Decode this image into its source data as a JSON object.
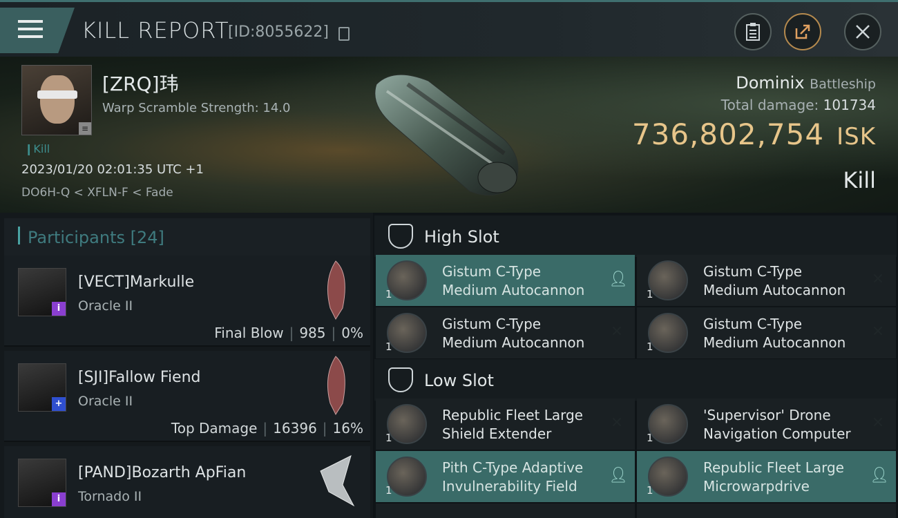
{
  "header": {
    "title": "KILL REPORT",
    "report_id": "[ID:8055622]"
  },
  "victim": {
    "name": "[ZRQ]玮",
    "warp_scramble": "Warp Scramble Strength: 14.0",
    "kill_tag": "Kill",
    "datetime": "2023/01/20 02:01:35 UTC +1",
    "location": "DO6H-Q < XFLN-F < Fade",
    "ship": "Dominix",
    "ship_class": "Battleship",
    "total_damage_label": "Total damage:",
    "total_damage": "101734",
    "isk_value": "736,802,754",
    "isk_unit": "ISK",
    "type": "Kill"
  },
  "participants": {
    "label": "Participants",
    "count": "[24]",
    "rows": [
      {
        "name": "[VECT]Markulle",
        "ship": "Oracle II",
        "role": "Final Blow",
        "damage": "985",
        "pct": "0%",
        "tag": "i",
        "tag_color": "#8a3fd0"
      },
      {
        "name": "[SJI]Fallow Fiend",
        "ship": "Oracle II",
        "role": "Top Damage",
        "damage": "16396",
        "pct": "16%",
        "tag": "+",
        "tag_color": "#2f4fcf"
      },
      {
        "name": "[PAND]Bozarth ApFian",
        "ship": "Tornado II",
        "role": "",
        "damage": "",
        "pct": "",
        "tag": "i",
        "tag_color": "#8a3fd0"
      }
    ]
  },
  "slots": {
    "high": {
      "label": "High Slot",
      "modules": [
        {
          "line1": "Gistum C-Type",
          "line2": "Medium Autocannon",
          "qty": "1",
          "status": "person"
        },
        {
          "line1": "Gistum C-Type",
          "line2": "Medium Autocannon",
          "qty": "1",
          "status": "x"
        },
        {
          "line1": "Gistum C-Type",
          "line2": "Medium Autocannon",
          "qty": "1",
          "status": "x"
        },
        {
          "line1": "Gistum C-Type",
          "line2": "Medium Autocannon",
          "qty": "1",
          "status": "x"
        }
      ]
    },
    "low": {
      "label": "Low Slot",
      "modules": [
        {
          "line1": "Republic Fleet Large",
          "line2": "Shield Extender",
          "qty": "1",
          "status": "x"
        },
        {
          "line1": "'Supervisor' Drone",
          "line2": "Navigation Computer",
          "qty": "1",
          "status": "x"
        },
        {
          "line1": "Pith C-Type Adaptive",
          "line2": "Invulnerability Field",
          "qty": "1",
          "status": "person"
        },
        {
          "line1": "Republic Fleet Large",
          "line2": "Microwarpdrive",
          "qty": "1",
          "status": "person"
        }
      ]
    }
  }
}
